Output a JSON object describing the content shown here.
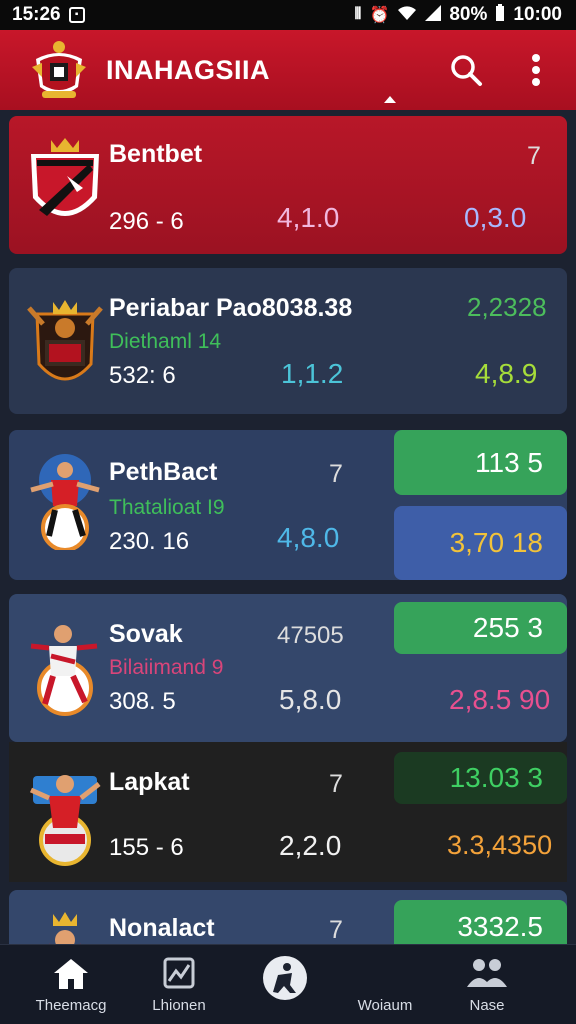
{
  "status_bar": {
    "time": "15:26",
    "battery": "80%",
    "clock": "10:00"
  },
  "app_bar": {
    "title": "INAHAGSIIA",
    "search_icon": "search-icon",
    "more_icon": "more-vert-icon"
  },
  "colors": {
    "brand_red": "#c8172a",
    "green": "#36a35a",
    "blue_pill": "#3e5ea8"
  },
  "matches": [
    {
      "name": "Bentbet",
      "sub": "",
      "score": "296 - 6",
      "tag": "7",
      "odd_mid": "4,1.0",
      "odd_right": "0,3.0"
    },
    {
      "name": "Periabar Pao8038.38",
      "sub": "Diethaml 14",
      "score": "532: 6",
      "tag": "",
      "odd_top": "2,2328",
      "odd_mid": "1,1.2",
      "odd_right": "4,8.9"
    },
    {
      "name": "PethBact",
      "sub": "Thatalioat I9",
      "score": "230. 16",
      "tag": "7",
      "odd_top": "113 5",
      "odd_mid": "4,8.0",
      "odd_right": "3,70 18"
    },
    {
      "name": "Sovak",
      "sub": "Bilaiimand  9",
      "score": "308. 5",
      "tag": "47505",
      "odd_top": "255 3",
      "odd_mid": "5,8.0",
      "odd_right": "2,8.5 90"
    },
    {
      "name": "Lapkat",
      "sub": "",
      "score": "155 - 6",
      "tag": "7",
      "odd_top": "13.03 3",
      "odd_mid": "2,2.0",
      "odd_right": "3.3,4350"
    },
    {
      "name": "Nonalact",
      "tag": "7",
      "odd_top": "3332.5"
    }
  ],
  "nav": [
    {
      "label": "Theemacg",
      "icon": "home-icon"
    },
    {
      "label": "Lhionen",
      "icon": "chart-icon"
    },
    {
      "label": "",
      "icon": "player-icon"
    },
    {
      "label": "Woiaum",
      "icon": ""
    },
    {
      "label": "Nase",
      "icon": "group-icon"
    }
  ]
}
